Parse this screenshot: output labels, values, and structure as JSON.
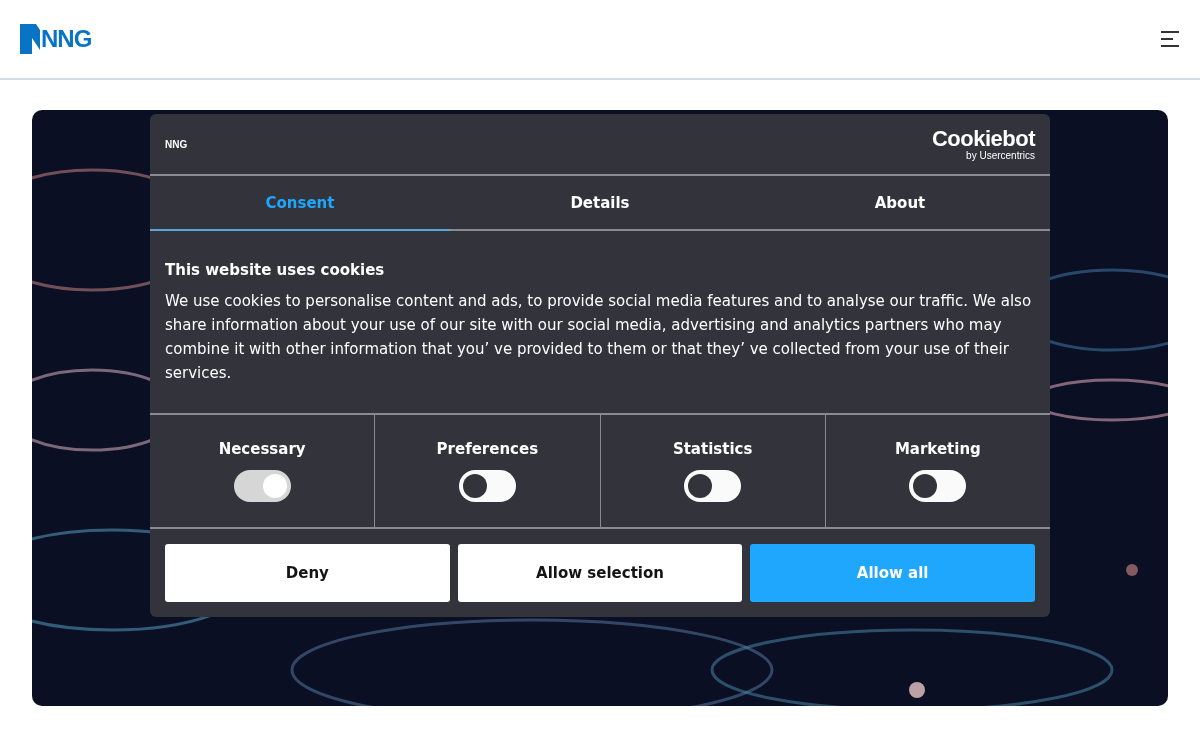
{
  "header": {
    "logo": "NNG"
  },
  "dialog": {
    "brand": "NNG",
    "provider": {
      "name": "Cookiebot",
      "tagline": "by Usercentrics"
    },
    "tabs": [
      {
        "label": "Consent",
        "selected": true
      },
      {
        "label": "Details",
        "selected": false
      },
      {
        "label": "About",
        "selected": false
      }
    ],
    "title": "This website uses cookies",
    "text": "We use cookies to personalise content and ads, to provide social media features and to analyse our traffic. We also share information about your use of our site with our social media, advertising and analytics partners who may combine it with other information that you’  ve provided to them or that they’  ve collected from your use of their services.",
    "categories": [
      {
        "label": "Necessary",
        "checked": true,
        "disabled": true
      },
      {
        "label": "Preferences",
        "checked": false,
        "disabled": false
      },
      {
        "label": "Statistics",
        "checked": false,
        "disabled": false
      },
      {
        "label": "Marketing",
        "checked": false,
        "disabled": false
      }
    ],
    "buttons": [
      {
        "label": "Deny",
        "kind": "secondary"
      },
      {
        "label": "Allow selection",
        "kind": "secondary"
      },
      {
        "label": "Allow all",
        "kind": "primary"
      }
    ]
  }
}
